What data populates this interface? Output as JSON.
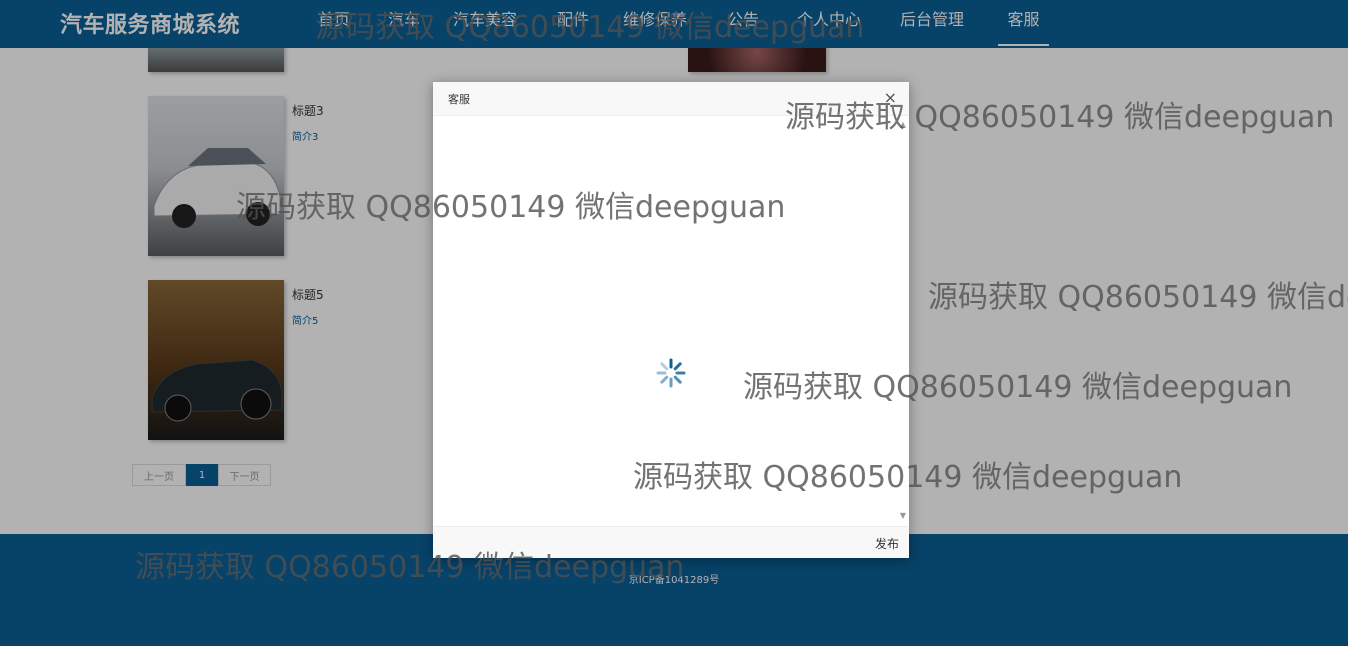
{
  "app": {
    "brand": "汽车服务商城系统"
  },
  "nav": {
    "items": [
      {
        "label": "首页"
      },
      {
        "label": "汽车"
      },
      {
        "label": "汽车美容"
      },
      {
        "label": "配件"
      },
      {
        "label": "维修保养"
      },
      {
        "label": "公告"
      },
      {
        "label": "个人中心"
      },
      {
        "label": "后台管理"
      },
      {
        "label": "客服"
      }
    ],
    "active_index": 8
  },
  "cards": [
    {
      "title": "标题3",
      "desc": "简介3"
    },
    {
      "title": "标题5",
      "desc": "简介5"
    }
  ],
  "pager": {
    "prev": "上一页",
    "current": "1",
    "next": "下一页"
  },
  "footer": {
    "icp": "京ICP备1041289号"
  },
  "modal": {
    "title": "客服",
    "close": "×",
    "publish": "发布"
  },
  "watermark": {
    "text": "源码获取 QQ86050149 微信deepguan",
    "truncated": "源码获取 QQ86050149 微信de"
  },
  "colors": {
    "primary": "#0b5f95",
    "accent": "#0b5f95"
  }
}
